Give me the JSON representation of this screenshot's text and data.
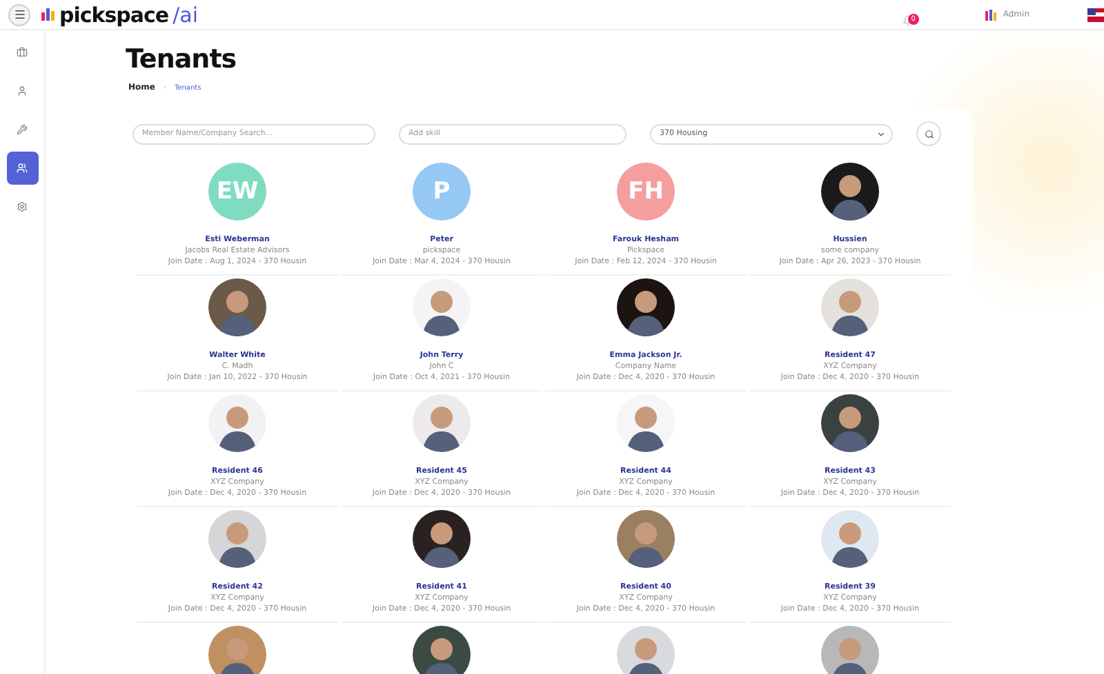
{
  "brand": {
    "name": "pickspace",
    "suffix": "/ai"
  },
  "header": {
    "notification_count": "0",
    "user": "Admin"
  },
  "sidebar": {
    "items": [
      {
        "kind": "briefcase",
        "selected": false
      },
      {
        "kind": "user",
        "selected": false
      },
      {
        "kind": "wrench",
        "selected": false
      },
      {
        "kind": "users",
        "selected": true
      },
      {
        "kind": "settings",
        "selected": false
      }
    ]
  },
  "page": {
    "title": "Tenants",
    "breadcrumb_separator": "›",
    "breadcrumb": [
      {
        "label": "Home",
        "selected": false
      },
      {
        "label": "Tenants",
        "selected": true
      }
    ]
  },
  "filters": {
    "search": {
      "placeholder": "Member Name/Company Search..."
    },
    "skill": {
      "placeholder": "Add skill"
    },
    "building": {
      "value": "370 Housing"
    }
  },
  "tenants": [
    {
      "kind": "initials",
      "initials": "EW",
      "color": "#7fdcc0",
      "name": "Esti Weberman",
      "company": "Jacobs Real Estate Advisors",
      "joined": "Join Date : Aug 1, 2024 - 370 Housin"
    },
    {
      "kind": "initials",
      "initials": "P",
      "color": "#96c8f4",
      "name": "Peter",
      "company": "pickspace",
      "joined": "Join Date : Mar 4, 2024 - 370 Housin"
    },
    {
      "kind": "initials",
      "initials": "FH",
      "color": "#f59e9e",
      "name": "Farouk Hesham",
      "company": "Pickspace",
      "joined": "Join Date : Feb 12, 2024 - 370 Housin"
    },
    {
      "name": "Hussien",
      "company": "some company",
      "joined": "Join Date : Apr 26, 2023 - 370 Housin"
    },
    {
      "name": "Walter White",
      "company": "C. Madh",
      "joined": "Join Date : Jan 10, 2022 - 370 Housin"
    },
    {
      "name": "John Terry",
      "company": "John C",
      "joined": "Join Date : Oct 4, 2021 - 370 Housin"
    },
    {
      "name": "Emma Jackson Jr.",
      "company": "Company Name",
      "joined": "Join Date : Dec 4, 2020 - 370 Housin"
    },
    {
      "name": "Resident 47",
      "company": "XYZ Company",
      "joined": "Join Date : Dec 4, 2020 - 370 Housin"
    },
    {
      "name": "Resident 46",
      "company": "XYZ Company",
      "joined": "Join Date : Dec 4, 2020 - 370 Housin"
    },
    {
      "name": "Resident 45",
      "company": "XYZ Company",
      "joined": "Join Date : Dec 4, 2020 - 370 Housin"
    },
    {
      "name": "Resident 44",
      "company": "XYZ Company",
      "joined": "Join Date : Dec 4, 2020 - 370 Housin"
    },
    {
      "name": "Resident 43",
      "company": "XYZ Company",
      "joined": "Join Date : Dec 4, 2020 - 370 Housin"
    },
    {
      "name": "Resident 42",
      "company": "XYZ Company",
      "joined": "Join Date : Dec 4, 2020 - 370 Housin"
    },
    {
      "name": "Resident 41",
      "company": "XYZ Company",
      "joined": "Join Date : Dec 4, 2020 - 370 Housin"
    },
    {
      "name": "Resident 40",
      "company": "XYZ Company",
      "joined": "Join Date : Dec 4, 2020 - 370 Housin"
    },
    {
      "name": "Resident 39",
      "company": "XYZ Company",
      "joined": "Join Date : Dec 4, 2020 - 370 Housin"
    },
    {
      "kind": "partial"
    },
    {
      "kind": "partial"
    },
    {
      "kind": "partial"
    },
    {
      "kind": "partial"
    }
  ]
}
